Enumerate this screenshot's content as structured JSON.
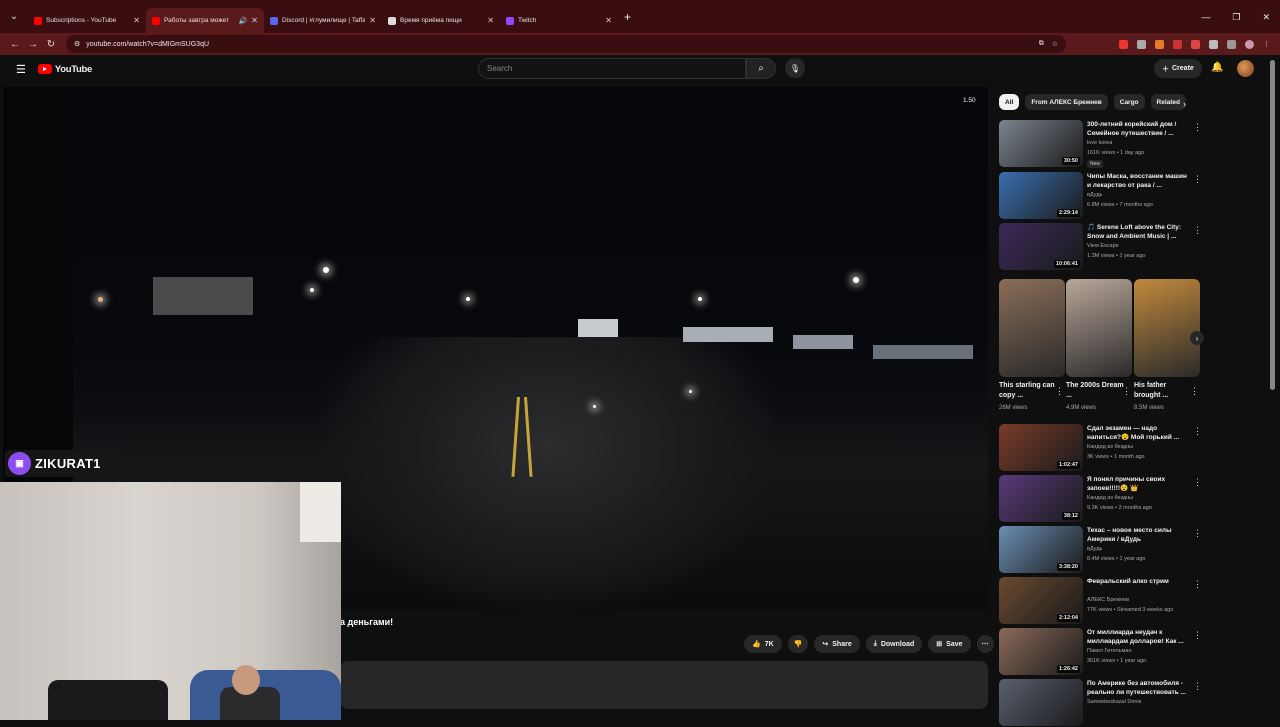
{
  "browser": {
    "tabs": [
      {
        "label": "Subscriptions - YouTube",
        "color": "#ff0000",
        "active": false
      },
      {
        "label": "Работы завтра может",
        "color": "#ff0000",
        "active": true
      },
      {
        "label": "Discord | #глумилище | Taffair",
        "color": "#5865f2",
        "active": false
      },
      {
        "label": "Время приёма пищи",
        "color": "#dddddd",
        "active": false
      },
      {
        "label": "Twitch",
        "color": "#9146ff",
        "active": false
      }
    ],
    "url": "youtube.com/watch?v=dMIGmSUG3qU"
  },
  "header": {
    "logo": "YouTube",
    "search_placeholder": "Search",
    "create_label": "Create"
  },
  "player": {
    "speed": "1.50",
    "caption": "а деньгами!"
  },
  "actions": {
    "likes": "7K",
    "share": "Share",
    "download": "Download",
    "save": "Save"
  },
  "streamer": {
    "name": "ZIKURAT1"
  },
  "chips": [
    "All",
    "From АЛЕКС Брежнев",
    "Cargo",
    "Related"
  ],
  "videos_top": [
    {
      "title": "300-летний корейский дом / Семейное путешествие / ...",
      "channel": "love korea",
      "meta": "161K views • 1 day ago",
      "badge": "New",
      "duration": "30:50",
      "thumb": "#7c8590"
    },
    {
      "title": "Чипы Маска, восстание машин и лекарство от рака / ...",
      "channel": "вДудь",
      "meta": "6.8M views • 7 months ago",
      "badge": "",
      "duration": "2:29:14",
      "thumb": "#3a6fb0"
    },
    {
      "title": "🎵 Serene Loft above the City: Snow and Ambient Music | ...",
      "channel": "View Escape",
      "meta": "1.3M views • 1 year ago",
      "badge": "",
      "duration": "10:06:41",
      "thumb": "#3b2a5a"
    }
  ],
  "shorts": [
    {
      "title": "This starling can copy ...",
      "views": "26M views",
      "thumb": "#8a6e58"
    },
    {
      "title": "The 2000s Dream ...",
      "views": "4.9M views",
      "thumb": "#b9a79a"
    },
    {
      "title": "His father brought ...",
      "views": "8.5M views",
      "thumb": "#c28a3c"
    }
  ],
  "videos_bottom": [
    {
      "title": "Сдал экзамен — надо напиться?😵 Мой горький ...",
      "channel": "Кандид из бездны",
      "meta": "3K views • 1 month ago",
      "duration": "1:02:47",
      "thumb": "#7a3b2a"
    },
    {
      "title": "Я понял причины своих запоев!!!!!😵 👑",
      "channel": "Кандид из бездны",
      "meta": "9.3K views • 2 months ago",
      "duration": "38:12",
      "thumb": "#5a3a7a"
    },
    {
      "title": "Техас – новое место силы Америки / вДудь",
      "channel": "вДудь",
      "meta": "8.4M views • 1 year ago",
      "duration": "3:38:20",
      "thumb": "#6b8fb5"
    },
    {
      "title": "Февральский алко стрим",
      "channel": "АЛЕКС Брежнев",
      "meta": "77K views • Streamed 3 weeks ago",
      "duration": "2:12:04",
      "thumb": "#6a4a30"
    },
    {
      "title": "От миллиарда неудач к миллиардам долларов! Как ...",
      "channel": "Павел Гительман",
      "meta": "361K views • 1 year ago",
      "duration": "1:26:42",
      "thumb": "#8b6a5a"
    },
    {
      "title": "По Америке без автомобиля - реально ли путешествовать ...",
      "channel": "Samsebeskazal Denis",
      "meta": "",
      "duration": "",
      "thumb": "#5a6070"
    }
  ]
}
